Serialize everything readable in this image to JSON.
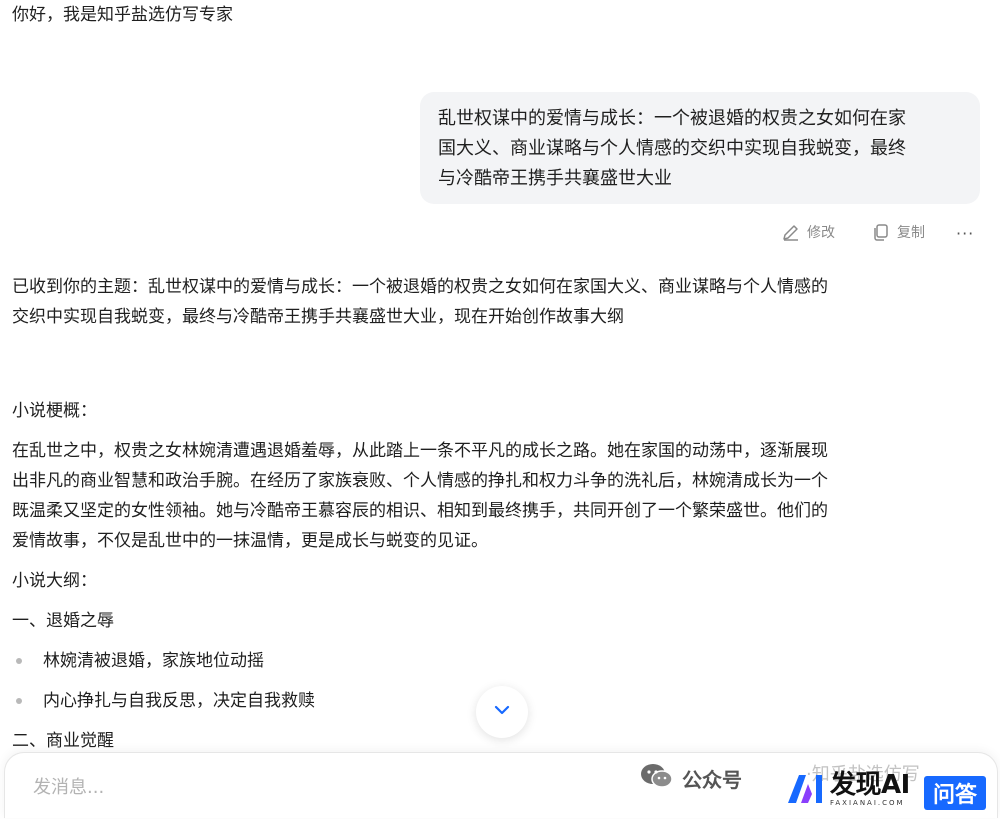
{
  "greeting": "你好，我是知乎盐选仿写专家",
  "user_message": {
    "lines": [
      "乱世权谋中的爱情与成长：一个被退婚的权贵之女如何在家",
      "国大义、商业谋略与个人情感的交织中实现自我蜕变，最终",
      "与冷酷帝王携手共襄盛世大业"
    ]
  },
  "actions": {
    "edit_label": "修改",
    "copy_label": "复制",
    "more_label": "···"
  },
  "response": {
    "intro_lines": [
      "已收到你的主题：乱世权谋中的爱情与成长：一个被退婚的权贵之女如何在家国大义、商业谋略与个人情感的",
      "交织中实现自我蜕变，最终与冷酷帝王携手共襄盛世大业，现在开始创作故事大纲"
    ],
    "summary_title": "小说梗概：",
    "summary_lines": [
      "在乱世之中，权贵之女林婉清遭遇退婚羞辱，从此踏上一条不平凡的成长之路。她在家国的动荡中，逐渐展现",
      "出非凡的商业智慧和政治手腕。在经历了家族衰败、个人情感的挣扎和权力斗争的洗礼后，林婉清成长为一个",
      "既温柔又坚定的女性领袖。她与冷酷帝王慕容辰的相识、相知到最终携手，共同开创了一个繁荣盛世。他们的",
      "爱情故事，不仅是乱世中的一抹温情，更是成长与蜕变的见证。"
    ],
    "outline_title": "小说大纲：",
    "section1_title": "一、退婚之辱",
    "section1_items": [
      "林婉清被退婚，家族地位动摇",
      "内心挣扎与自我反思，决定自我救赎"
    ],
    "section2_title": "二、商业觉醒"
  },
  "composer": {
    "placeholder": "发消息..."
  },
  "watermark": {
    "wechat_text": "公众号",
    "faint_text": "·知乎盐选仿写"
  },
  "logo": {
    "main": "发现AI",
    "sub": "FAXIANAI.COM",
    "badge": "问答"
  },
  "colors": {
    "bubble": "#f3f4f6",
    "accent": "#1769ff",
    "muted": "#8a8a8a"
  }
}
